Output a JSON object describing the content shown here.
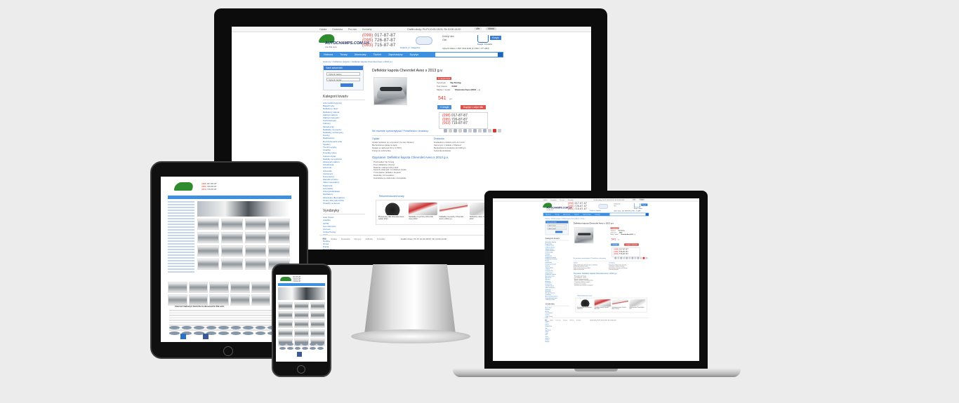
{
  "site": {
    "top_links": [
      "Oplata",
      "Dostavka",
      "Pro nas",
      "Kontakty"
    ],
    "work_hours": "Grafik roboty: Pn-Pt 10:00-18:00, Sb 10:00-14:00",
    "lang": "Ukr",
    "login": "Vkhid",
    "logo_text": "AUTOCHAMPS.COM.UA",
    "logo_sub": "vse dlia avto",
    "phones": [
      {
        "code": "(098)",
        "num": "017-87-87"
      },
      {
        "code": "(095)",
        "num": "726-87-87"
      },
      {
        "code": "(063)",
        "num": "715-87-87"
      }
    ],
    "callback": "Zamovyty zvorotnii dzvinok",
    "address": "Kharkiv, pr. Gagarina",
    "greeting": [
      "Dobryi den",
      "Gist"
    ],
    "currency": "Vyberit valiutu: USD  UAH  EUR  (1 USD = 27 UAH)",
    "cart_label": "Kosyk: 0 tovariv",
    "cart_button": "Kosyk",
    "nav": [
      "Holovna",
      "Tovary",
      "Aksesuary",
      "Tiuninh",
      "Zapchastyny",
      "Dyvytys"
    ],
    "search_placeholder": "Poshuk"
  },
  "breadcrumbs": "Holovna > Deflektory kapota > Deflektor kapota Chevrolet Aveo s 2013 g.v.",
  "sidebar": {
    "autoselect_title": "Vash avtomobil",
    "select_brand": "Vyberit marku",
    "select_model": "Vyberit model",
    "categories_title": "Kategorii tovariv",
    "categories": [
      "Avtomobilni kylymky",
      "Bagazhnyky",
      "Deflektory vikon",
      "Deflektory kapota",
      "Zakhyst kartera",
      "Zakhyst bamperiv",
      "Kenhuriatnyky",
      "Farkopy",
      "Molodovyky",
      "Nakladky na porohy",
      "Nakladky na bampery",
      "Porohy",
      "Reikhrelinhy",
      "Rozshyriuvachi arok",
      "Spoilery",
      "Tiuninh optyky",
      "Chekhly",
      "Kovpaky koles",
      "Koliosni dyski",
      "Nakidky na sydinnia",
      "Aksesuary salonu",
      "Avtokhimiia",
      "Avtozvuk",
      "Avtosvitlo",
      "Instrument",
      "Kompresory",
      "Zariadni prystroi",
      "Video reiestratory",
      "Parktronik",
      "Antyradary",
      "Avtosyhnalizatsiia",
      "Navihatory",
      "Aksesuary dlia telefonu",
      "Tovary dlia podorozhei",
      "Chekhly na kermo"
    ],
    "manufacturers_title": "Vyrobnyky",
    "manufacturers": [
      "Auto Clover",
      "Autoflex",
      "AVTM",
      "Can Otomotiv",
      "Carmos",
      "Cobra Tuning",
      "EGR",
      "Hic",
      "Novline",
      "Omsa",
      "Polcar",
      "Rezaw-Plast",
      "Sim",
      "Vip Tuning",
      "Winbo",
      "Lada",
      "Fort",
      "Sotra",
      "Skyway",
      "Drakon",
      "Elegant"
    ]
  },
  "product": {
    "title": "Deflektor kapota Chevrolet Aveo s 2013 g.v.",
    "badge": "V nayavnosti",
    "spec": [
      {
        "label": "Vyrobnyk:",
        "value": "Vip Tuning"
      },
      {
        "label": "Kod tovaru:",
        "value": "CH13"
      },
      {
        "label": "Marka / model:",
        "value": "Chevrolet Aveo (2013 -...)"
      }
    ],
    "price": "541",
    "price_unit": "grn",
    "buy_button": "V kosyk",
    "buy_one_click": "Kupyty v odyn klik",
    "callback_phones": [
      {
        "code": "(098)",
        "num": "017-87-87"
      },
      {
        "code": "(095)",
        "num": "726-87-87"
      },
      {
        "code": "(063)",
        "num": "715-87-87"
      }
    ],
    "callback_note": "Zamovyty zvorotnii dzvinok",
    "share": "Ne mozhete vyznachytysia? Porad'tesia z druziamy:"
  },
  "payment": {
    "title": "Oplata",
    "items": [
      "Oplata hotivkoiu pry otrymanni (za vsiu Ukrainu)",
      "Bezhotivkova oplata na kartu",
      "Oplata na rakhunok firmy (z PDV)",
      "Kredyt ta rozstrochka"
    ]
  },
  "delivery": {
    "title": "Dostavka",
    "items": [
      "Dostavka po Ukraini vid 1 do 3 dniv",
      "Samovyviz zi skladu v Kharkovi",
      "Bezkoshtovna dostavka vid 1000 grn",
      "Kurierska dostavka"
    ]
  },
  "description": {
    "title": "Opysanie: Deflektor kapota Chevrolet Aveo s 2013 g.v.",
    "lines": [
      "Proizvoditel: Vip Tuning",
      "Tsvet deflektora: chernyi",
      "Material: udaroprochnyi akril",
      "Sposob ustanovki: na shtatnye mesta",
      "V komplekte: deflektor, krepezh",
      "Garantiia: 12 mesiatsev",
      "Instruktsiia po ustanovke v komplekte"
    ]
  },
  "related": {
    "title": "Rekomendovani tovary",
    "items": [
      "Bryzgovyky dlia Chevrolet Aveo sedan 2012",
      "Nakladky na porohy Chevrolet Aveo 2012",
      "Nakladky na porohy Chevrolet Aveo s 2012 g.v.",
      "Deflektory vikon Chevrolet Aveo 2012"
    ]
  },
  "footer": {
    "links": [
      "Stati",
      "Oplata",
      "Dostavka",
      "Novyny",
      "Vidhuky",
      "Kontakty"
    ],
    "hours": "Grafik roboty: Pn-Pt 10:00-18:00, Sb 10:00-14:00"
  },
  "tablet": {
    "slogan": "Internet-mahazyn tiuninhu ta aksesuariv dlia avto"
  }
}
